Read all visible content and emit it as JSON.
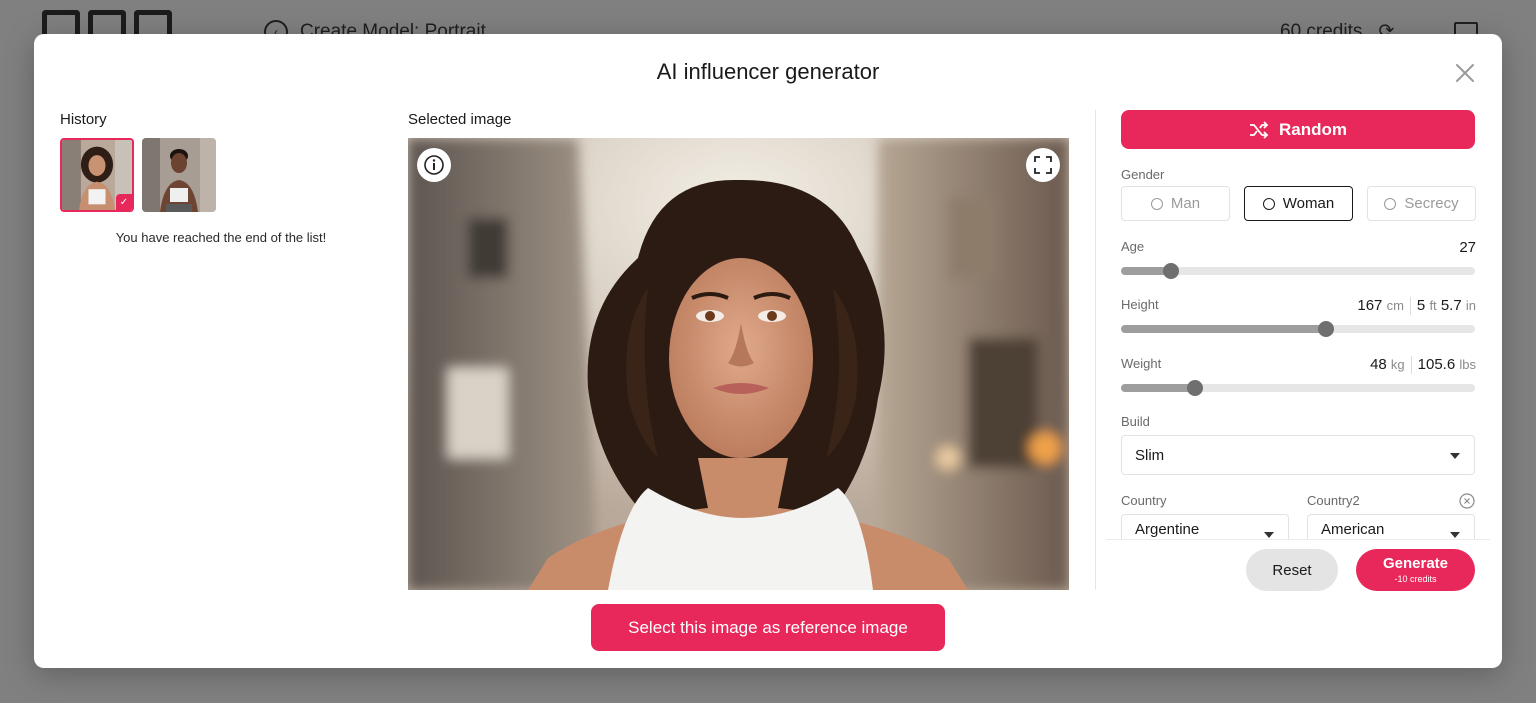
{
  "background": {
    "page_title": "Create Model: Portrait",
    "credits": "60 credits"
  },
  "modal": {
    "title": "AI influencer generator",
    "close_icon": "close-icon"
  },
  "history": {
    "label": "History",
    "end_text": "You have reached the end of the list!"
  },
  "selected": {
    "label": "Selected image",
    "reference_button": "Select this image as reference image"
  },
  "form": {
    "random_label": "Random",
    "gender_label": "Gender",
    "gender_options": [
      "Man",
      "Woman",
      "Secrecy"
    ],
    "gender_selected": "Woman",
    "age_label": "Age",
    "age_value": "27",
    "age_fraction": 0.14,
    "height_label": "Height",
    "height_cm": "167",
    "height_cm_unit": "cm",
    "height_ft": "5",
    "height_ft_unit": "ft",
    "height_in": "5.7",
    "height_in_unit": "in",
    "height_fraction": 0.58,
    "weight_label": "Weight",
    "weight_kg": "48",
    "weight_kg_unit": "kg",
    "weight_lbs": "105.6",
    "weight_lbs_unit": "lbs",
    "weight_fraction": 0.21,
    "build_label": "Build",
    "build_value": "Slim",
    "country_label": "Country",
    "country_value": "Argentine",
    "country2_label": "Country2",
    "country2_value": "American"
  },
  "actions": {
    "reset": "Reset",
    "generate": "Generate",
    "generate_cost": "-10 credits"
  },
  "colors": {
    "accent": "#e8285a"
  }
}
